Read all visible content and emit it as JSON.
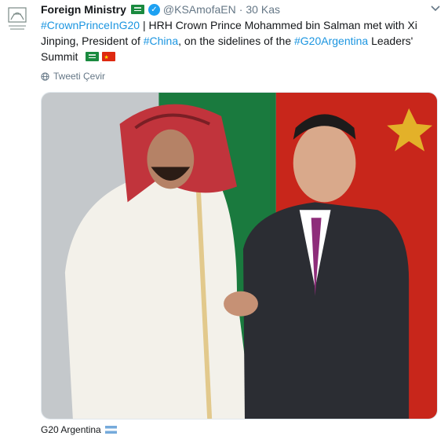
{
  "tweet": {
    "author_name": "Foreign Ministry",
    "author_handle": "@KSAmofaEN",
    "separator": "·",
    "timestamp": "30 Kas",
    "text_segments": [
      {
        "type": "hashtag",
        "text": "#CrownPrinceInG20"
      },
      {
        "type": "text",
        "text": " | HRH Crown Prince Mohammed bin Salman met with Xi Jinping, President of "
      },
      {
        "type": "hashtag",
        "text": "#China"
      },
      {
        "type": "text",
        "text": ", on the sidelines of the "
      },
      {
        "type": "hashtag",
        "text": "#G20Argentina"
      },
      {
        "type": "text",
        "text": " Leaders' Summit"
      }
    ],
    "translate_label": "Tweeti Çevir",
    "location_label": "G20 Argentina"
  },
  "icons": {
    "avatar": "ministry-emblem",
    "verified": "verified-badge-icon",
    "menu": "chevron-down-icon",
    "translate": "globe-icon"
  },
  "colors": {
    "link": "#1b95e0",
    "muted": "#657786",
    "verified": "#1da1f2",
    "saudi_green": "#1a8a3f",
    "china_red": "#de2910"
  }
}
